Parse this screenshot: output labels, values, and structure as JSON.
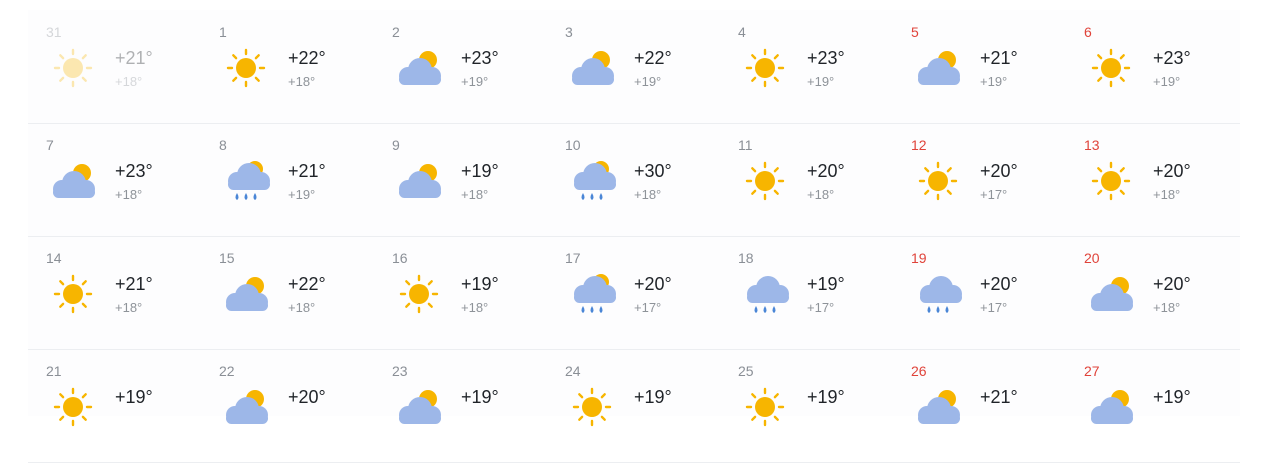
{
  "colors": {
    "sun": "#f7b500",
    "cloud": "#9db7e8",
    "rain": "#4a86d6",
    "weekend": "#e0433a"
  },
  "weeks": [
    {
      "days": [
        {
          "day": "31",
          "hi": "+21°",
          "lo": "+18°",
          "icon": "sun-icon",
          "weekend": false,
          "past": true
        },
        {
          "day": "1",
          "hi": "+22°",
          "lo": "+18°",
          "icon": "sun-icon",
          "weekend": false
        },
        {
          "day": "2",
          "hi": "+23°",
          "lo": "+19°",
          "icon": "partly-cloudy-icon",
          "weekend": false
        },
        {
          "day": "3",
          "hi": "+22°",
          "lo": "+19°",
          "icon": "partly-cloudy-icon",
          "weekend": false
        },
        {
          "day": "4",
          "hi": "+23°",
          "lo": "+19°",
          "icon": "sun-icon",
          "weekend": false
        },
        {
          "day": "5",
          "hi": "+21°",
          "lo": "+19°",
          "icon": "partly-cloudy-icon",
          "weekend": true
        },
        {
          "day": "6",
          "hi": "+23°",
          "lo": "+19°",
          "icon": "sun-icon",
          "weekend": true
        }
      ]
    },
    {
      "days": [
        {
          "day": "7",
          "hi": "+23°",
          "lo": "+18°",
          "icon": "partly-cloudy-icon",
          "weekend": false
        },
        {
          "day": "8",
          "hi": "+21°",
          "lo": "+19°",
          "icon": "rain-sun-icon",
          "weekend": false
        },
        {
          "day": "9",
          "hi": "+19°",
          "lo": "+18°",
          "icon": "partly-cloudy-icon",
          "weekend": false
        },
        {
          "day": "10",
          "hi": "+30°",
          "lo": "+18°",
          "icon": "rain-sun-icon",
          "weekend": false
        },
        {
          "day": "11",
          "hi": "+20°",
          "lo": "+18°",
          "icon": "sun-icon",
          "weekend": false
        },
        {
          "day": "12",
          "hi": "+20°",
          "lo": "+17°",
          "icon": "sun-icon",
          "weekend": true
        },
        {
          "day": "13",
          "hi": "+20°",
          "lo": "+18°",
          "icon": "sun-icon",
          "weekend": true
        }
      ]
    },
    {
      "days": [
        {
          "day": "14",
          "hi": "+21°",
          "lo": "+18°",
          "icon": "sun-icon",
          "weekend": false
        },
        {
          "day": "15",
          "hi": "+22°",
          "lo": "+18°",
          "icon": "partly-cloudy-icon",
          "weekend": false
        },
        {
          "day": "16",
          "hi": "+19°",
          "lo": "+18°",
          "icon": "sun-icon",
          "weekend": false
        },
        {
          "day": "17",
          "hi": "+20°",
          "lo": "+17°",
          "icon": "rain-sun-icon",
          "weekend": false
        },
        {
          "day": "18",
          "hi": "+19°",
          "lo": "+17°",
          "icon": "rain-icon",
          "weekend": false
        },
        {
          "day": "19",
          "hi": "+20°",
          "lo": "+17°",
          "icon": "rain-icon",
          "weekend": true
        },
        {
          "day": "20",
          "hi": "+20°",
          "lo": "+18°",
          "icon": "partly-cloudy-icon",
          "weekend": true
        }
      ]
    },
    {
      "days": [
        {
          "day": "21",
          "hi": "+19°",
          "lo": "",
          "icon": "sun-icon",
          "weekend": false
        },
        {
          "day": "22",
          "hi": "+20°",
          "lo": "",
          "icon": "partly-cloudy-icon",
          "weekend": false
        },
        {
          "day": "23",
          "hi": "+19°",
          "lo": "",
          "icon": "partly-cloudy-icon",
          "weekend": false
        },
        {
          "day": "24",
          "hi": "+19°",
          "lo": "",
          "icon": "sun-icon",
          "weekend": false
        },
        {
          "day": "25",
          "hi": "+19°",
          "lo": "",
          "icon": "sun-icon",
          "weekend": false
        },
        {
          "day": "26",
          "hi": "+21°",
          "lo": "",
          "icon": "partly-cloudy-icon",
          "weekend": true
        },
        {
          "day": "27",
          "hi": "+19°",
          "lo": "",
          "icon": "partly-cloudy-icon",
          "weekend": true
        }
      ]
    }
  ]
}
